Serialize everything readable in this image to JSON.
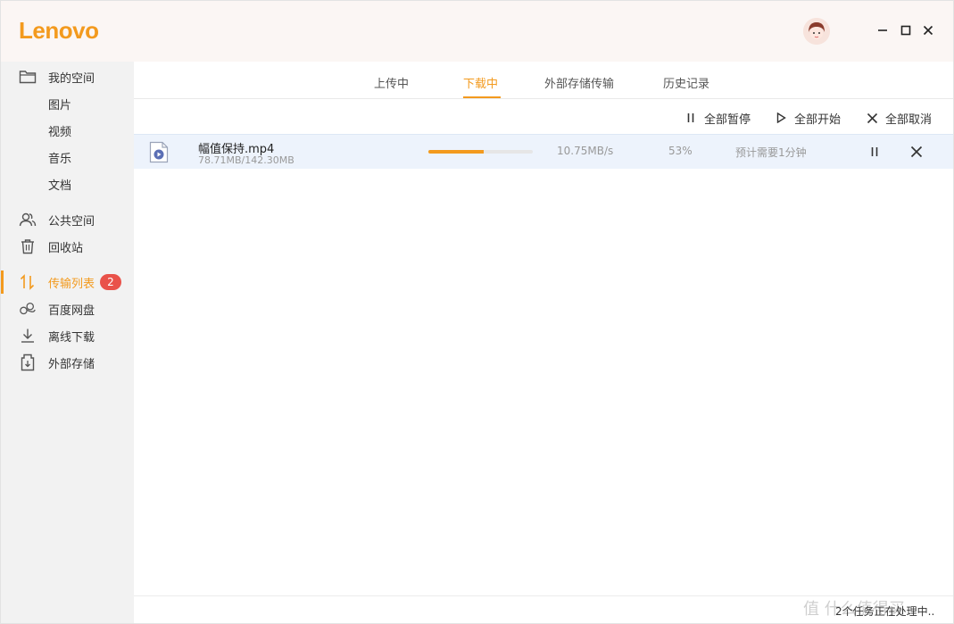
{
  "app": {
    "logo_text": "Lenovo",
    "brand_color": "#f39a1e"
  },
  "window_controls": {
    "minimize_icon": "minimize-icon",
    "maximize_icon": "maximize-icon",
    "close_icon": "close-icon"
  },
  "sidebar": {
    "items": [
      {
        "label": "我的空间",
        "icon": "folder-icon"
      },
      {
        "label": "图片"
      },
      {
        "label": "视频"
      },
      {
        "label": "音乐"
      },
      {
        "label": "文档"
      },
      {
        "label": "公共空间",
        "icon": "users-icon"
      },
      {
        "label": "回收站",
        "icon": "trash-icon"
      },
      {
        "label": "传输列表",
        "icon": "transfer-icon",
        "badge": "2",
        "active": true
      },
      {
        "label": "百度网盘",
        "icon": "cloud-link-icon"
      },
      {
        "label": "离线下载",
        "icon": "download-icon"
      },
      {
        "label": "外部存储",
        "icon": "usb-drive-icon"
      }
    ]
  },
  "tabs": [
    {
      "label": "上传中"
    },
    {
      "label": "下载中",
      "active": true
    },
    {
      "label": "外部存储传输"
    },
    {
      "label": "历史记录"
    }
  ],
  "toolbar": {
    "pause_all": "全部暂停",
    "start_all": "全部开始",
    "cancel_all": "全部取消"
  },
  "downloads": [
    {
      "file_name": "幅值保持.mp4",
      "size": "78.71MB/142.30MB",
      "progress": 0.53,
      "speed": "10.75MB/s",
      "percent": "53%",
      "eta": "预计需要1分钟"
    }
  ],
  "status": {
    "text": "2个任务正在处理中..",
    "watermark": "值 什么值得买"
  }
}
